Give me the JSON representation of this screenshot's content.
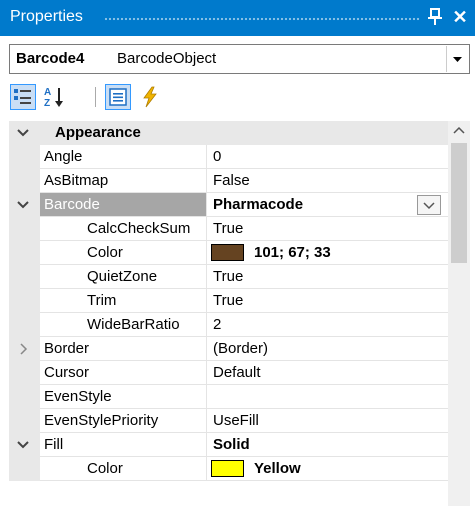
{
  "panel": {
    "title": "Properties"
  },
  "object_selector": {
    "name": "Barcode4",
    "type": "BarcodeObject"
  },
  "rows": [
    {
      "name": "Appearance",
      "value": ""
    },
    {
      "name": "Angle",
      "value": "0"
    },
    {
      "name": "AsBitmap",
      "value": "False"
    },
    {
      "name": "Barcode",
      "value": "Pharmacode"
    },
    {
      "name": "CalcCheckSum",
      "value": "True"
    },
    {
      "name": "Color",
      "value": "101; 67; 33",
      "color": "#654321"
    },
    {
      "name": "QuietZone",
      "value": "True"
    },
    {
      "name": "Trim",
      "value": "True"
    },
    {
      "name": "WideBarRatio",
      "value": "2"
    },
    {
      "name": "Border",
      "value": "(Border)"
    },
    {
      "name": "Cursor",
      "value": "Default"
    },
    {
      "name": "EvenStyle",
      "value": ""
    },
    {
      "name": "EvenStylePriority",
      "value": "UseFill"
    },
    {
      "name": "Fill",
      "value": "Solid"
    },
    {
      "name": "Color",
      "value": "Yellow",
      "color": "#ffff00"
    }
  ],
  "colors": {
    "accent": "#007acc",
    "selection": "#a6a6a6",
    "category_bg": "#e8e8e8"
  }
}
